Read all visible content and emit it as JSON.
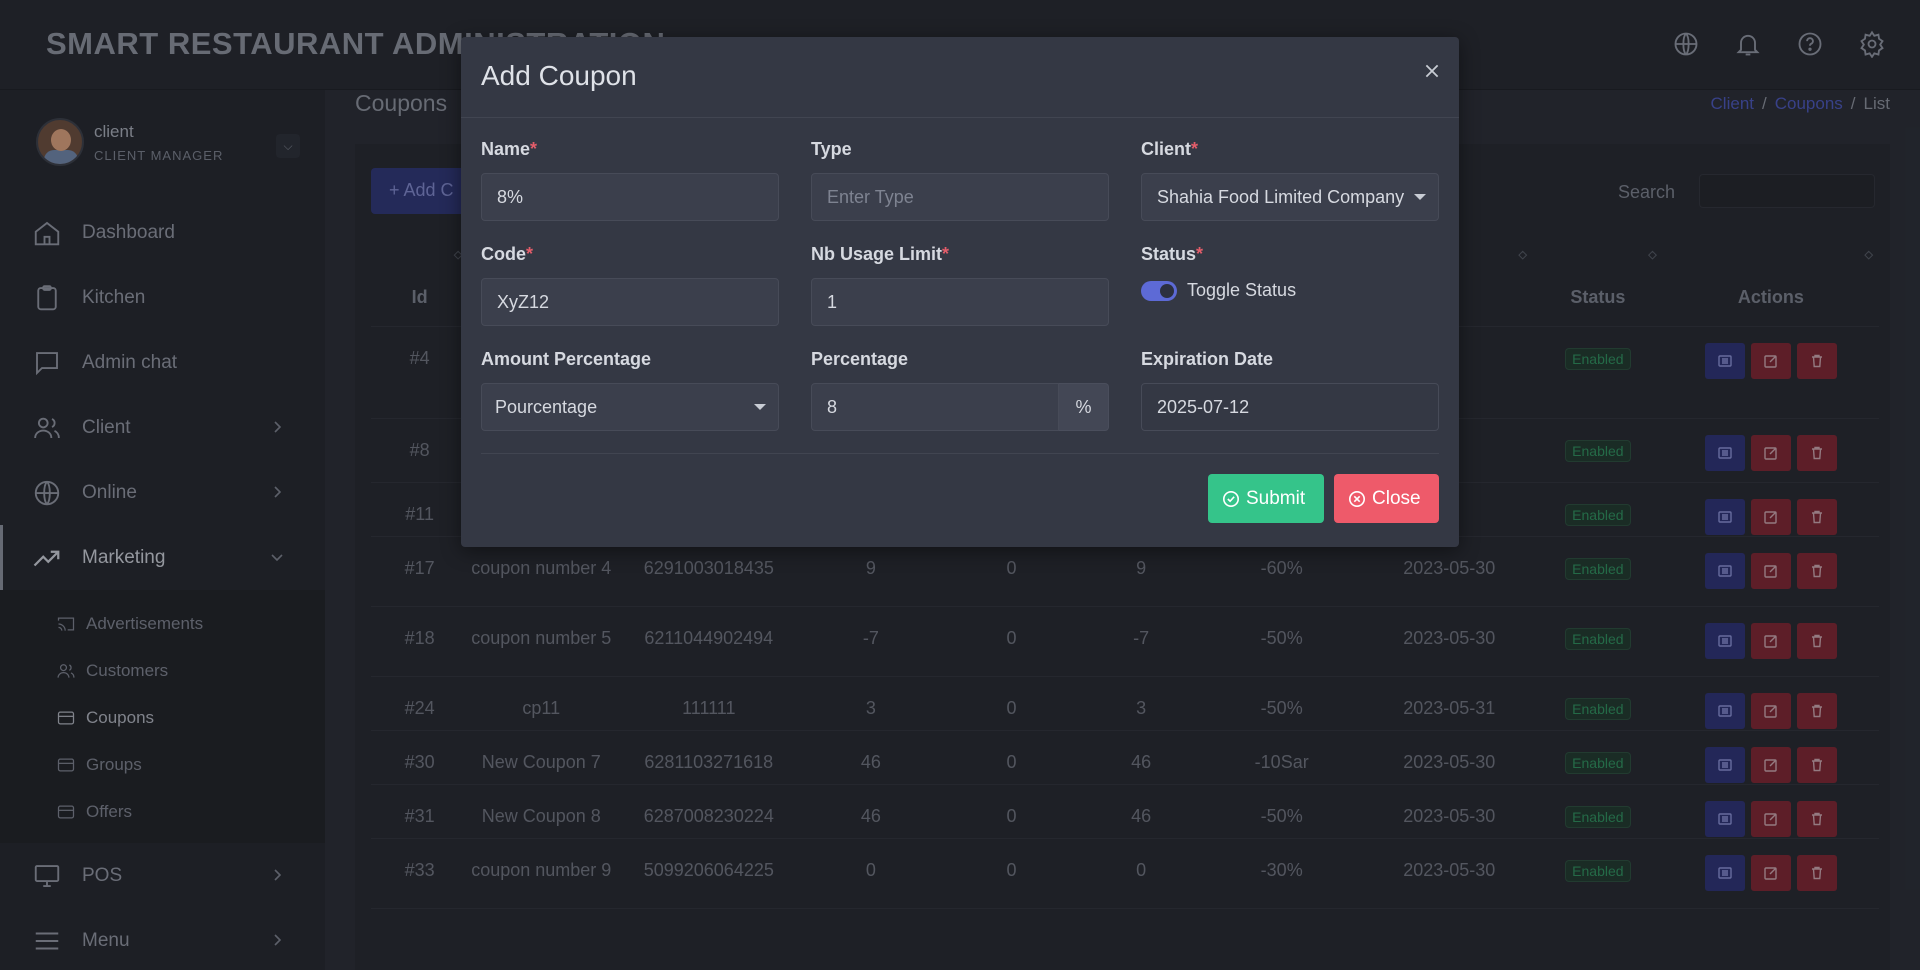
{
  "app": {
    "title": "SMART RESTAURANT ADMINISTRATION",
    "top_icons": [
      "globe-icon",
      "bell-icon",
      "help-icon",
      "settings-icon"
    ]
  },
  "user": {
    "name": "client",
    "role": "CLIENT MANAGER"
  },
  "sidebar": {
    "items": [
      {
        "label": "Dashboard",
        "icon": "home-icon"
      },
      {
        "label": "Kitchen",
        "icon": "clipboard-icon"
      },
      {
        "label": "Admin chat",
        "icon": "chat-icon"
      },
      {
        "label": "Client",
        "icon": "users-icon"
      },
      {
        "label": "Online",
        "icon": "globe-icon"
      },
      {
        "label": "Marketing",
        "icon": "trend-icon"
      },
      {
        "label": "POS",
        "icon": "monitor-icon"
      },
      {
        "label": "Menu",
        "icon": "menu-icon"
      }
    ],
    "sub_items": [
      {
        "label": "Advertisements",
        "icon": "cast-icon"
      },
      {
        "label": "Customers",
        "icon": "users-icon"
      },
      {
        "label": "Coupons",
        "icon": "card-icon"
      },
      {
        "label": "Groups",
        "icon": "card-icon"
      },
      {
        "label": "Offers",
        "icon": "card-icon"
      }
    ]
  },
  "page": {
    "title": "Coupons",
    "breadcrumb": [
      "Client",
      "Coupons",
      "List"
    ],
    "add_button": "+ Add C",
    "search_label": "Search"
  },
  "table": {
    "headers": [
      "Id",
      "",
      "",
      "",
      "",
      "",
      "",
      "",
      "Status",
      "Actions"
    ],
    "rows": [
      {
        "id": "#4",
        "name": "",
        "code": "",
        "c1": "",
        "c2": "",
        "c3": "",
        "amount": "",
        "date": "",
        "status": "Enabled"
      },
      {
        "id": "#8",
        "name": "",
        "code": "",
        "c1": "",
        "c2": "",
        "c3": "",
        "amount": "",
        "date": "",
        "status": "Enabled"
      },
      {
        "id": "#11",
        "name": "",
        "code": "",
        "c1": "",
        "c2": "",
        "c3": "",
        "amount": "",
        "date": "",
        "status": "Enabled"
      },
      {
        "id": "#17",
        "name": "coupon number 4",
        "code": "6291003018435",
        "c1": "9",
        "c2": "0",
        "c3": "9",
        "amount": "-60%",
        "date": "2023-05-30",
        "status": "Enabled"
      },
      {
        "id": "#18",
        "name": "coupon number 5",
        "code": "6211044902494",
        "c1": "-7",
        "c2": "0",
        "c3": "-7",
        "amount": "-50%",
        "date": "2023-05-30",
        "status": "Enabled"
      },
      {
        "id": "#24",
        "name": "cp11",
        "code": "111111",
        "c1": "3",
        "c2": "0",
        "c3": "3",
        "amount": "-50%",
        "date": "2023-05-31",
        "status": "Enabled"
      },
      {
        "id": "#30",
        "name": "New Coupon 7",
        "code": "6281103271618",
        "c1": "46",
        "c2": "0",
        "c3": "46",
        "amount": "-10Sar",
        "date": "2023-05-30",
        "status": "Enabled"
      },
      {
        "id": "#31",
        "name": "New Coupon 8",
        "code": "6287008230224",
        "c1": "46",
        "c2": "0",
        "c3": "46",
        "amount": "-50%",
        "date": "2023-05-30",
        "status": "Enabled"
      },
      {
        "id": "#33",
        "name": "coupon number 9",
        "code": "5099206064225",
        "c1": "0",
        "c2": "0",
        "c3": "0",
        "amount": "-30%",
        "date": "2023-05-30",
        "status": "Enabled"
      }
    ]
  },
  "modal": {
    "title": "Add Coupon",
    "fields": {
      "name": {
        "label": "Name",
        "value": "8%"
      },
      "type": {
        "label": "Type",
        "placeholder": "Enter Type",
        "value": ""
      },
      "client": {
        "label": "Client",
        "value": "Shahia Food Limited Company"
      },
      "code": {
        "label": "Code",
        "value": "XyZ12"
      },
      "usage_limit": {
        "label": "Nb Usage Limit",
        "value": "1"
      },
      "status": {
        "label": "Status",
        "toggle_label": "Toggle Status",
        "on": true
      },
      "amount_percentage": {
        "label": "Amount Percentage",
        "value": "Pourcentage"
      },
      "percentage": {
        "label": "Percentage",
        "value": "8",
        "addon": "%"
      },
      "expiration": {
        "label": "Expiration Date",
        "value": "2025-07-12"
      }
    },
    "required_mark": "*",
    "submit": "Submit",
    "close": "Close"
  },
  "colors": {
    "accent": "#5d6ad6",
    "submit": "#35c48a",
    "close": "#ee5a6a",
    "danger": "#7d2632"
  }
}
